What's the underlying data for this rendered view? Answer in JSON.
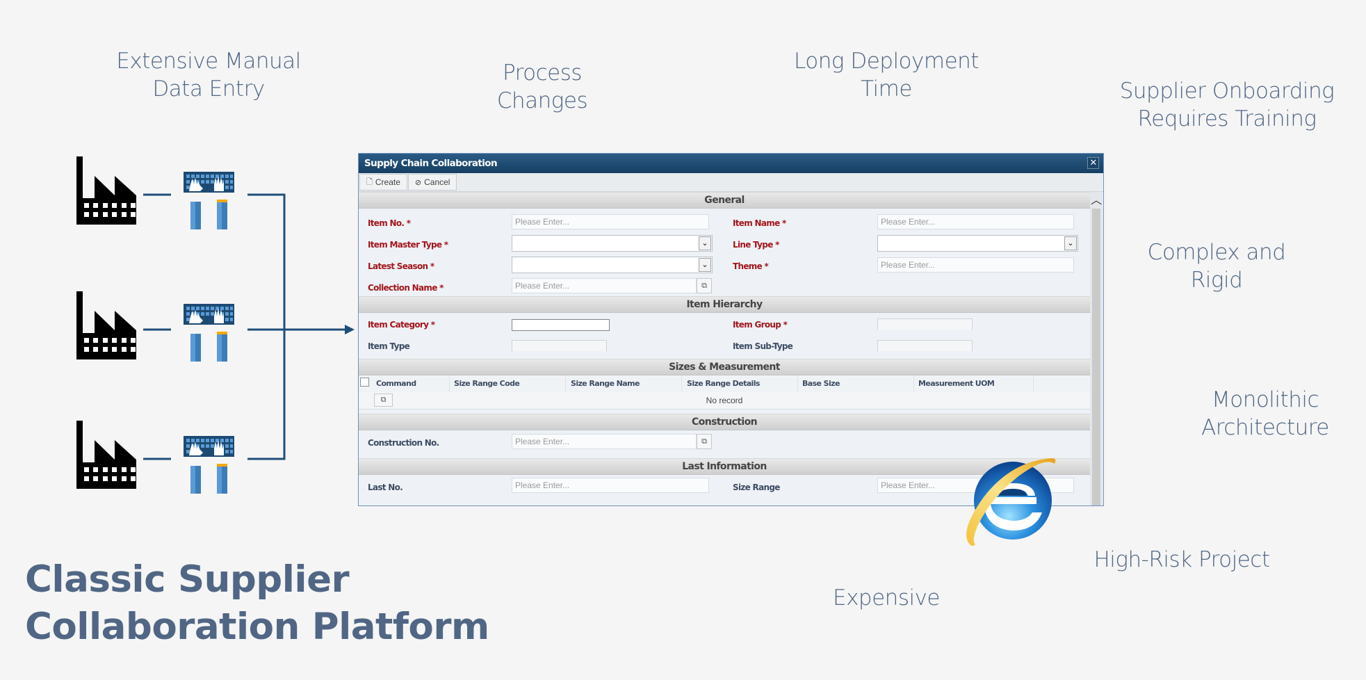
{
  "slide": {
    "title": "Classic Supplier\nCollaboration Platform",
    "callouts": {
      "manual_entry": "Extensive Manual\nData Entry",
      "process_changes": "Process\nChanges",
      "long_deployment": "Long Deployment\nTime",
      "onboarding": "Supplier Onboarding\nRequires Training",
      "complex": "Complex and\nRigid",
      "monolithic": "Monolithic\nArchitecture",
      "high_risk": "High-Risk Project",
      "expensive": "Expensive"
    },
    "colors": {
      "text": "#506684",
      "connector": "#1f4e79",
      "window_title_bar": "#1b4569",
      "required_label": "#a3161d",
      "keyboard_blue": "#5b9bd5",
      "accent_orange": "#f5a800"
    },
    "diagram": {
      "supplier_count": 3,
      "icons": [
        "factory-icon",
        "keyboard-typing-icon",
        "arrow-icon"
      ]
    }
  },
  "window": {
    "title": "Supply Chain Collaboration",
    "close_icon": "close-icon",
    "toolbar": {
      "create_label": "Create",
      "cancel_label": "Cancel"
    },
    "placeholder": "Please Enter...",
    "sections": {
      "general": {
        "title": "General",
        "item_no": "Item No. *",
        "item_name": "Item Name *",
        "item_master_type": "Item Master Type *",
        "line_type": "Line Type *",
        "latest_season": "Latest Season *",
        "theme": "Theme *",
        "collection_name": "Collection Name *"
      },
      "hierarchy": {
        "title": "Item Hierarchy",
        "item_category": "Item Category *",
        "item_group": "Item Group *",
        "item_type": "Item Type",
        "item_sub_type": "Item Sub-Type"
      },
      "sizes": {
        "title": "Sizes & Measurement",
        "columns": [
          "Command",
          "Size Range Code",
          "Size Range Name",
          "Size Range Details",
          "Base Size",
          "Measurement UOM"
        ],
        "empty_text": "No record"
      },
      "construction": {
        "title": "Construction",
        "construction_no": "Construction No."
      },
      "last_info": {
        "title": "Last Information",
        "last_no": "Last No.",
        "size_range": "Size Range"
      }
    }
  }
}
